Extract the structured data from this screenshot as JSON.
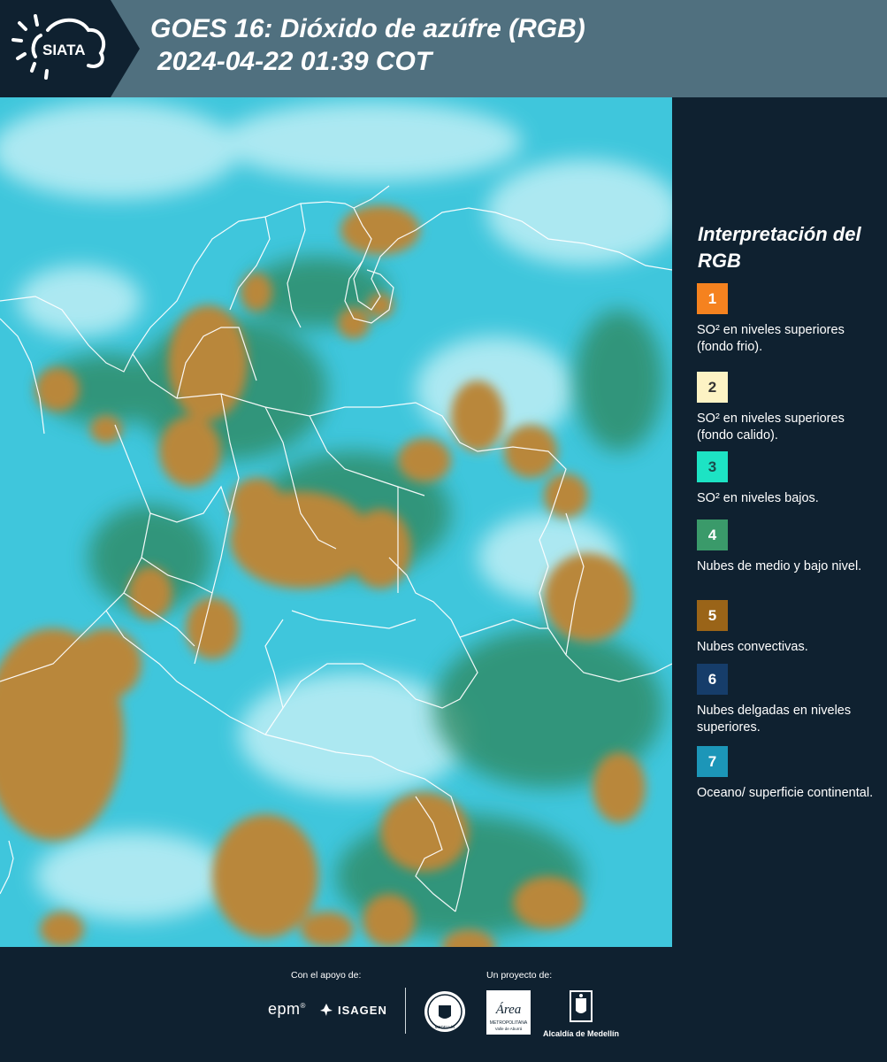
{
  "header": {
    "logo_text": "SIATA",
    "title_line1": "GOES 16: Dióxido de azúfre (RGB)",
    "title_line2": "2024-04-22 01:39 COT"
  },
  "map": {
    "description_colors": {
      "ocean_cyan": "#3fc6dc",
      "cloud_brown": "#b9873a",
      "mid_cloud_green": "#2f8a63",
      "borders": "#ffffff"
    }
  },
  "legend": {
    "title": "Interpretación del RGB",
    "items": [
      {
        "number": "1",
        "color": "#f5821f",
        "number_color": "#ffffff",
        "text": "SO² en niveles superiores (fondo frio)."
      },
      {
        "number": "2",
        "color": "#fdf3c4",
        "number_color": "#333333",
        "text": "SO² en niveles superiores (fondo calido)."
      },
      {
        "number": "3",
        "color": "#1de3c4",
        "number_color": "#1b4b4b",
        "text": "SO² en niveles bajos."
      },
      {
        "number": "4",
        "color": "#3a9a6a",
        "number_color": "#ffffff",
        "text": "Nubes de medio y bajo nivel."
      },
      {
        "number": "5",
        "color": "#9a6418",
        "number_color": "#ffffff",
        "text": "Nubes convectivas."
      },
      {
        "number": "6",
        "color": "#163d6a",
        "number_color": "#ffffff",
        "text": "Nubes delgadas en niveles superiores."
      },
      {
        "number": "7",
        "color": "#1c96b8",
        "number_color": "#ffffff",
        "text": "Oceano/ superficie continental."
      }
    ]
  },
  "footer": {
    "support_label": "Con el apoyo de:",
    "project_label": "Un proyecto de:",
    "epm_text": "epm",
    "epm_mark": "®",
    "isagen_text": "ISAGEN",
    "seal_text": "MEDELLÍN",
    "area_text": "Área",
    "area_sub": "METROPOLITANA",
    "area_sub2": "Valle de Aburrá",
    "alcaldia_text": "Alcaldía de Medellín"
  }
}
